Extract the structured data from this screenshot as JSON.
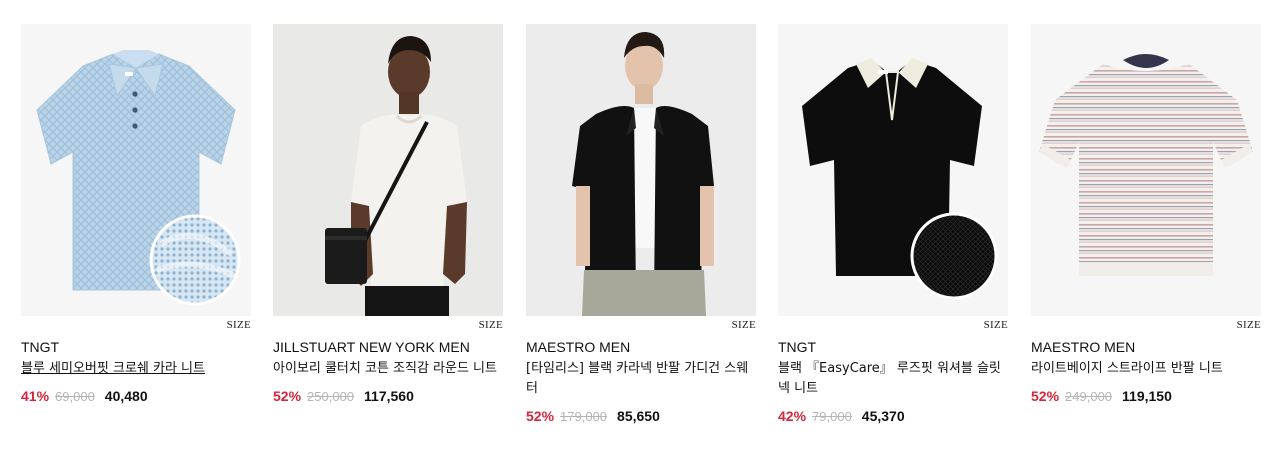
{
  "colors": {
    "discount": "#d6263a",
    "original_price": "#b5b5b5",
    "text": "#111111"
  },
  "products": [
    {
      "brand": "TNGT",
      "name": "블루 세미오버핏 크로쉐 카라 니트",
      "discount": "41%",
      "original_price": "69,000",
      "final_price": "40,480",
      "size_label": "SIZE",
      "image": "light-blue-crochet-polo-knit-with-detail-circle"
    },
    {
      "brand": "JILLSTUART NEW YORK MEN",
      "name": "아이보리 쿨터치 코튼 조직감 라운드 니트",
      "discount": "52%",
      "original_price": "250,000",
      "final_price": "117,560",
      "size_label": "SIZE",
      "image": "model-in-ivory-knit-tee-with-crossbody-bag"
    },
    {
      "brand": "MAESTRO MEN",
      "name": "[타임리스] 블랙 카라넥 반팔 가디건 스웨터",
      "discount": "52%",
      "original_price": "179,000",
      "final_price": "85,650",
      "size_label": "SIZE",
      "image": "model-in-black-short-sleeve-cardigan"
    },
    {
      "brand": "TNGT",
      "name": "블랙 『EasyCare』 루즈핏 워셔블 슬릿넥 니트",
      "discount": "42%",
      "original_price": "79,000",
      "final_price": "45,370",
      "size_label": "SIZE",
      "image": "black-slit-neck-knit-with-cream-collar"
    },
    {
      "brand": "MAESTRO MEN",
      "name": "라이트베이지 스트라이프 반팔 니트",
      "discount": "52%",
      "original_price": "249,000",
      "final_price": "119,150",
      "size_label": "SIZE",
      "image": "light-beige-striped-short-sleeve-knit"
    }
  ]
}
